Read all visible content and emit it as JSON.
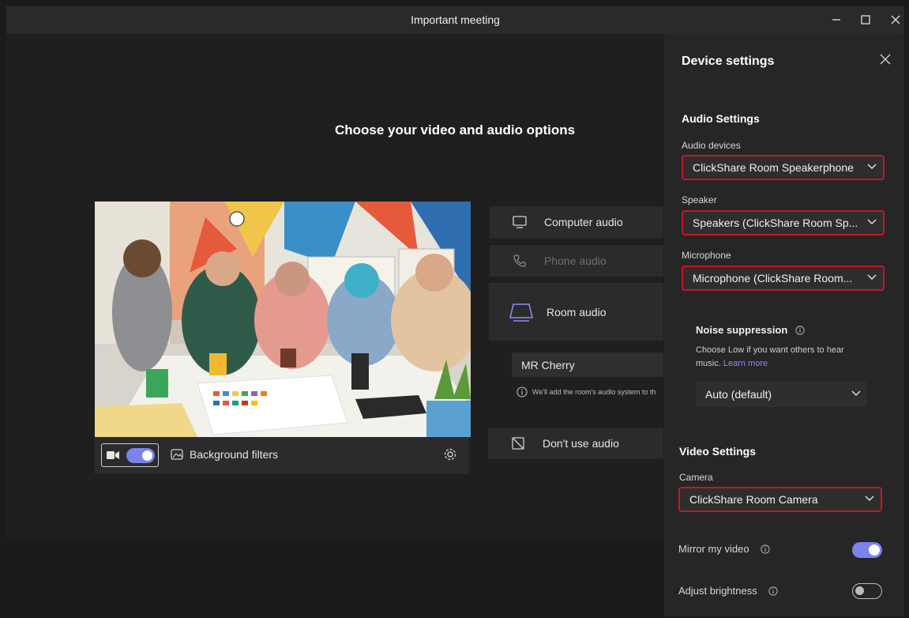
{
  "window": {
    "title": "Important meeting"
  },
  "stage": {
    "heading": "Choose your video and audio options"
  },
  "preview": {
    "background_filters_label": "Background filters",
    "camera_on": true
  },
  "audio_options": {
    "computer": "Computer audio",
    "phone": "Phone audio",
    "room": "Room audio",
    "room_name": "MR Cherry",
    "room_note": "We'll add the room's audio system to th",
    "none": "Don't use audio"
  },
  "panel": {
    "title": "Device settings",
    "audio_section": "Audio Settings",
    "audio_devices_label": "Audio devices",
    "audio_devices_value": "ClickShare Room Speakerphone",
    "speaker_label": "Speaker",
    "speaker_value": "Speakers (ClickShare Room Sp...",
    "microphone_label": "Microphone",
    "microphone_value": "Microphone (ClickShare Room...",
    "noise_title": "Noise suppression",
    "noise_text": "Choose Low if you want others to hear music.",
    "noise_learn_more": "Learn more",
    "noise_value": "Auto (default)",
    "video_section": "Video Settings",
    "camera_label": "Camera",
    "camera_value": "ClickShare Room Camera",
    "mirror_label": "Mirror my video",
    "mirror_on": true,
    "brightness_label": "Adjust brightness",
    "brightness_on": false
  },
  "colors": {
    "accent": "#7b83eb",
    "highlight_border": "#c4162a",
    "panel_bg": "#262626"
  }
}
